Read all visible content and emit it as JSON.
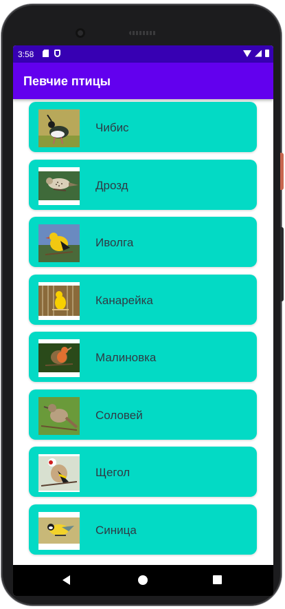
{
  "status_bar": {
    "time": "3:58"
  },
  "app_bar": {
    "title": "Певчие птицы"
  },
  "birds": [
    {
      "name": "Чибис"
    },
    {
      "name": "Дрозд"
    },
    {
      "name": "Иволга"
    },
    {
      "name": "Канарейка"
    },
    {
      "name": "Малиновка"
    },
    {
      "name": "Соловей"
    },
    {
      "name": "Щегол"
    },
    {
      "name": "Синица"
    }
  ],
  "colors": {
    "status_bar": "#3700b3",
    "app_bar": "#6200ee",
    "card": "#03dac5"
  }
}
